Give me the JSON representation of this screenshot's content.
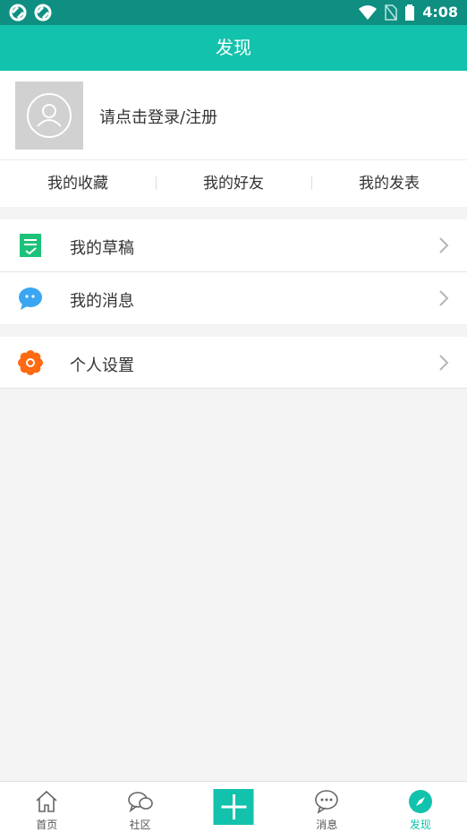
{
  "status_bar": {
    "time": "4:08"
  },
  "title_bar": {
    "title": "发现"
  },
  "profile": {
    "login_prompt": "请点击登录/注册"
  },
  "quick_tabs": [
    "我的收藏",
    "我的好友",
    "我的发表"
  ],
  "menu_group_1": [
    {
      "label": "我的草稿",
      "icon": "draft-icon",
      "color": "#1dc27a"
    },
    {
      "label": "我的消息",
      "icon": "message-icon",
      "color": "#3aa6f2"
    }
  ],
  "menu_group_2": [
    {
      "label": "个人设置",
      "icon": "settings-gear-icon",
      "color": "#ff6a13"
    }
  ],
  "bottom_nav": {
    "items": [
      {
        "label": "首页",
        "icon": "home-icon"
      },
      {
        "label": "社区",
        "icon": "community-chat-icon"
      },
      {
        "label": "",
        "icon": "plus-icon"
      },
      {
        "label": "消息",
        "icon": "message-bubble-icon"
      },
      {
        "label": "发现",
        "icon": "compass-icon",
        "active": true
      }
    ]
  },
  "colors": {
    "accent": "#12c2ac",
    "status_bar": "#0f8f82"
  }
}
